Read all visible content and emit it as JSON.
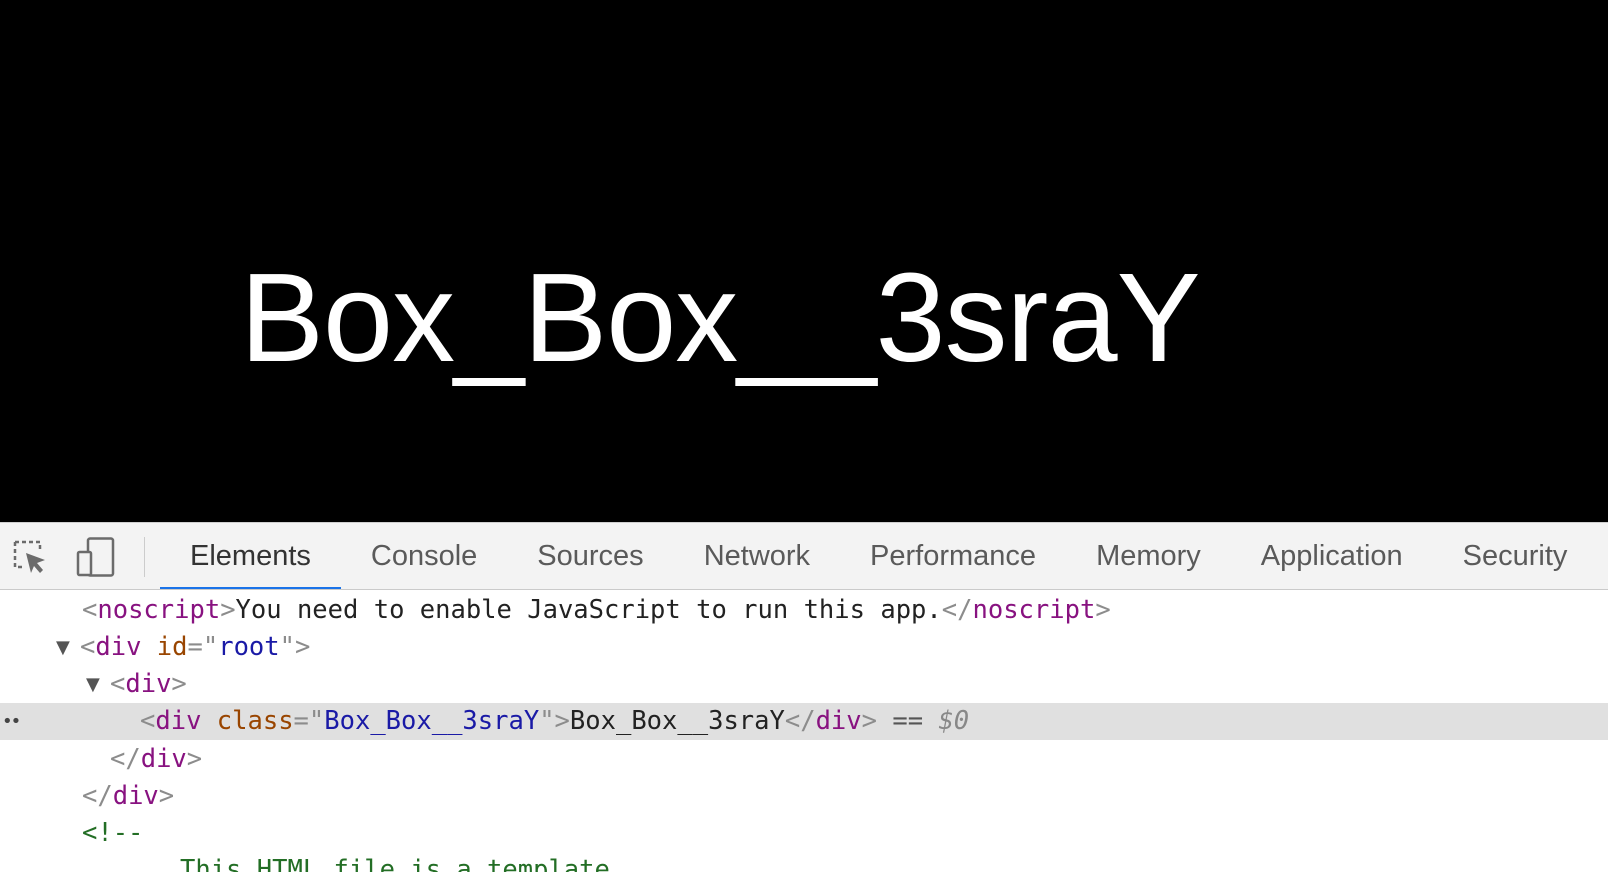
{
  "viewport": {
    "rendered_text": "Box_Box__3sraY",
    "background": "#000000",
    "text_color": "#ffffff"
  },
  "devtools": {
    "toolbar": {
      "inspect_icon": "inspect-element-icon",
      "device_icon": "device-toolbar-icon"
    },
    "tabs": [
      {
        "label": "Elements",
        "active": true
      },
      {
        "label": "Console"
      },
      {
        "label": "Sources"
      },
      {
        "label": "Network"
      },
      {
        "label": "Performance"
      },
      {
        "label": "Memory"
      },
      {
        "label": "Application"
      },
      {
        "label": "Security"
      }
    ],
    "active_tab_color": "#1a73e8",
    "dom": {
      "noscript": {
        "tag": "noscript",
        "text": "You need to enable JavaScript to run this app."
      },
      "root": {
        "tag": "div",
        "attr_name": "id",
        "attr_value": "root"
      },
      "inner_div": {
        "tag": "div"
      },
      "selected": {
        "tag": "div",
        "attr_name": "class",
        "attr_value": "Box_Box__3sraY",
        "text": "Box_Box__3sraY",
        "console_ref": "$0",
        "ref_prefix": "=="
      },
      "close_inner": "div",
      "close_root": "div",
      "comment_open": "<!--",
      "comment_text": "This HTML file is a template."
    }
  }
}
